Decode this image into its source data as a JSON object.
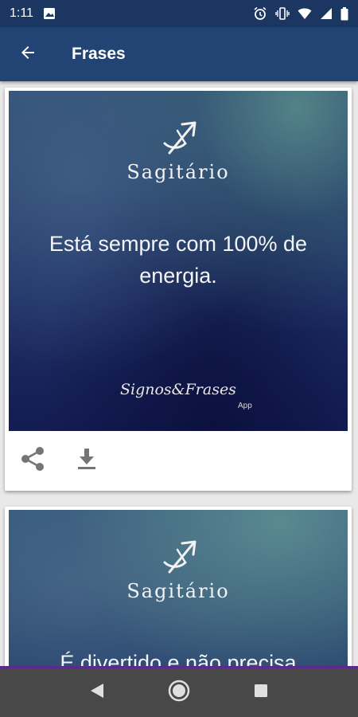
{
  "status_bar": {
    "time": "1:11",
    "icons": [
      "image-icon",
      "alarm-icon",
      "vibrate-icon",
      "wifi-icon",
      "signal-icon",
      "battery-icon"
    ]
  },
  "app_bar": {
    "title": "Frases",
    "back_icon": "arrow-left-icon"
  },
  "colors": {
    "status_bar": "#1b3661",
    "app_bar": "#214474",
    "nav_bar": "#484848",
    "nav_accent": "#5b2a8c"
  },
  "cards": [
    {
      "sign": "Sagitário",
      "quote": "Está sempre com 100% de energia.",
      "watermark": "Signos&Frases",
      "watermark_sub": "App",
      "actions": [
        "share-icon",
        "download-icon"
      ]
    },
    {
      "sign": "Sagitário",
      "quote": "É divertido e não precisa"
    }
  ],
  "nav": [
    "back-triangle-icon",
    "home-circle-icon",
    "recents-square-icon"
  ]
}
